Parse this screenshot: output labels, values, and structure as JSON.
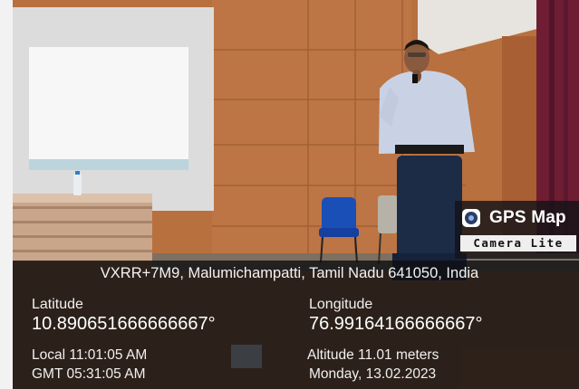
{
  "watermark": {
    "app_name": "GPS Map",
    "app_edition": "Camera Lite",
    "icon": "camera-lens-icon"
  },
  "location": {
    "address": "VXRR+7M9, Malumichampatti, Tamil Nadu 641050, India",
    "latitude_label": "Latitude",
    "latitude_value": "10.890651666666667°",
    "longitude_label": "Longitude",
    "longitude_value": "76.99164166666667°",
    "local_time": "Local 11:01:05 AM",
    "gmt_time": "GMT 05:31:05 AM",
    "altitude": "Altitude 11.01 meters",
    "date": "Monday, 13.02.2023"
  },
  "colors": {
    "wall": "#b8703f",
    "panel": "#0e1012",
    "badge": "#141418"
  }
}
